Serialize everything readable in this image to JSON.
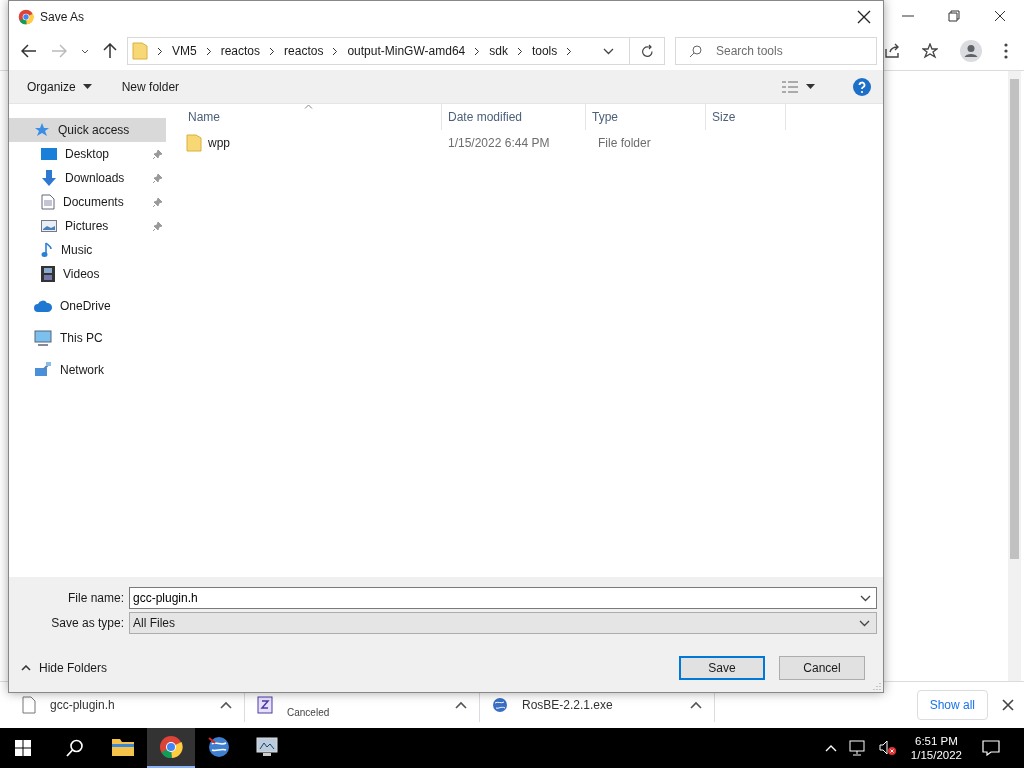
{
  "dialog": {
    "title": "Save As",
    "breadcrumbs": [
      "VM5",
      "reactos",
      "reactos",
      "output-MinGW-amd64",
      "sdk",
      "tools"
    ],
    "search": {
      "placeholder": "Search tools"
    },
    "commands": [
      "Organize",
      "New folder"
    ],
    "nav": [
      {
        "label": "Quick access",
        "kind": "quick",
        "selected": true,
        "pinned": false,
        "children": [
          {
            "label": "Desktop",
            "kind": "desktop",
            "selected": false,
            "pinned": true
          },
          {
            "label": "Downloads",
            "kind": "downloads",
            "selected": false,
            "pinned": true
          },
          {
            "label": "Documents",
            "kind": "documents",
            "selected": false,
            "pinned": true
          },
          {
            "label": "Pictures",
            "kind": "pictures",
            "selected": false,
            "pinned": true
          },
          {
            "label": "Music",
            "kind": "music",
            "selected": false,
            "pinned": false
          },
          {
            "label": "Videos",
            "kind": "videos",
            "selected": false,
            "pinned": false
          }
        ]
      },
      {
        "label": "OneDrive",
        "kind": "onedrive",
        "selected": false,
        "pinned": false
      },
      {
        "label": "This PC",
        "kind": "pc",
        "selected": false,
        "pinned": false
      },
      {
        "label": "Network",
        "kind": "network",
        "selected": false,
        "pinned": false
      }
    ],
    "columns": [
      "Name",
      "Date modified",
      "Type",
      "Size"
    ],
    "rows": [
      {
        "name": "wpp",
        "date": "1/15/2022 6:44 PM",
        "type": "File folder"
      }
    ],
    "file_name": {
      "label": "File name:",
      "value": "gcc-plugin.h"
    },
    "save_type": {
      "label": "Save as type:",
      "value": "All Files"
    },
    "hide_folders": "Hide Folders",
    "buttons": [
      "Save",
      "Cancel"
    ]
  },
  "downloads": [
    {
      "name": "gcc-plugin.h",
      "kind": "file"
    },
    {
      "status": "Canceled",
      "kind": "zip"
    },
    {
      "name": "RosBE-2.2.1.exe",
      "kind": "exe"
    }
  ],
  "show_all": "Show all",
  "taskbar": {
    "apps": [
      {
        "kind": "explorer",
        "selected": false
      },
      {
        "kind": "chrome",
        "selected": true
      },
      {
        "kind": "globe",
        "selected": false
      },
      {
        "kind": "monitor",
        "selected": false
      }
    ],
    "time": "6:51 PM",
    "date": "1/15/2022"
  }
}
